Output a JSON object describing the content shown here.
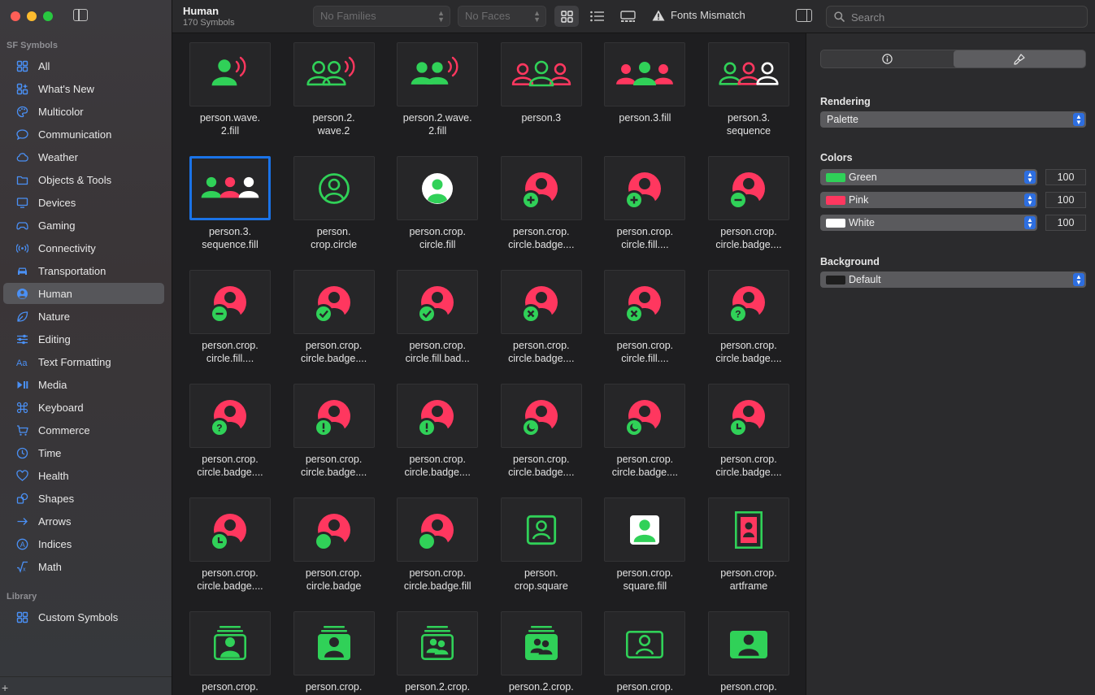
{
  "sidebar": {
    "section_symbols": "SF Symbols",
    "items": [
      {
        "label": "All",
        "icon": "grid-icon",
        "selected": false
      },
      {
        "label": "What's New",
        "icon": "sparkle-grid-icon",
        "selected": false
      },
      {
        "label": "Multicolor",
        "icon": "palette-icon",
        "selected": false
      },
      {
        "label": "Communication",
        "icon": "speech-bubble-icon",
        "selected": false
      },
      {
        "label": "Weather",
        "icon": "cloud-icon",
        "selected": false
      },
      {
        "label": "Objects & Tools",
        "icon": "folder-icon",
        "selected": false
      },
      {
        "label": "Devices",
        "icon": "desktop-icon",
        "selected": false
      },
      {
        "label": "Gaming",
        "icon": "gamecontroller-icon",
        "selected": false
      },
      {
        "label": "Connectivity",
        "icon": "antenna-icon",
        "selected": false
      },
      {
        "label": "Transportation",
        "icon": "car-icon",
        "selected": false
      },
      {
        "label": "Human",
        "icon": "person-circle-icon",
        "selected": true
      },
      {
        "label": "Nature",
        "icon": "leaf-icon",
        "selected": false
      },
      {
        "label": "Editing",
        "icon": "sliders-icon",
        "selected": false
      },
      {
        "label": "Text Formatting",
        "icon": "text-format-icon",
        "selected": false
      },
      {
        "label": "Media",
        "icon": "play-pause-icon",
        "selected": false
      },
      {
        "label": "Keyboard",
        "icon": "command-icon",
        "selected": false
      },
      {
        "label": "Commerce",
        "icon": "cart-icon",
        "selected": false
      },
      {
        "label": "Time",
        "icon": "clock-icon",
        "selected": false
      },
      {
        "label": "Health",
        "icon": "heart-icon",
        "selected": false
      },
      {
        "label": "Shapes",
        "icon": "shapes-icon",
        "selected": false
      },
      {
        "label": "Arrows",
        "icon": "arrow-right-icon",
        "selected": false
      },
      {
        "label": "Indices",
        "icon": "a-circle-icon",
        "selected": false
      },
      {
        "label": "Math",
        "icon": "square-root-icon",
        "selected": false
      }
    ],
    "section_library": "Library",
    "library_items": [
      {
        "label": "Custom Symbols",
        "icon": "grid-icon"
      }
    ],
    "add_label": "+"
  },
  "toolbar": {
    "title": "Human",
    "subtitle": "170 Symbols",
    "families_placeholder": "No Families",
    "faces_placeholder": "No Faces",
    "fonts_mismatch": "Fonts Mismatch",
    "search_placeholder": "Search"
  },
  "symbols": [
    {
      "label": "person.wave.\n2.fill",
      "icon": "person-wave-2-fill"
    },
    {
      "label": "person.2.\nwave.2",
      "icon": "person-2-wave-2"
    },
    {
      "label": "person.2.wave.\n2.fill",
      "icon": "person-2-wave-2-fill"
    },
    {
      "label": "person.3",
      "icon": "person-3"
    },
    {
      "label": "person.3.fill",
      "icon": "person-3-fill"
    },
    {
      "label": "person.3.\nsequence",
      "icon": "person-3-sequence"
    },
    {
      "label": "person.3.\nsequence.fill",
      "icon": "person-3-sequence-fill",
      "selected": true
    },
    {
      "label": "person.\ncrop.circle",
      "icon": "person-crop-circle"
    },
    {
      "label": "person.crop.\ncircle.fill",
      "icon": "person-crop-circle-fill"
    },
    {
      "label": "person.crop.\ncircle.badge....",
      "icon": "badge-plus"
    },
    {
      "label": "person.crop.\ncircle.fill....",
      "icon": "badge-plus-fill"
    },
    {
      "label": "person.crop.\ncircle.badge....",
      "icon": "badge-minus"
    },
    {
      "label": "person.crop.\ncircle.fill....",
      "icon": "badge-minus-fill"
    },
    {
      "label": "person.crop.\ncircle.badge....",
      "icon": "badge-check"
    },
    {
      "label": "person.crop.\ncircle.fill.bad...",
      "icon": "badge-check-fill"
    },
    {
      "label": "person.crop.\ncircle.badge....",
      "icon": "badge-x"
    },
    {
      "label": "person.crop.\ncircle.fill....",
      "icon": "badge-x-fill"
    },
    {
      "label": "person.crop.\ncircle.badge....",
      "icon": "badge-question"
    },
    {
      "label": "person.crop.\ncircle.badge....",
      "icon": "badge-question-fill"
    },
    {
      "label": "person.crop.\ncircle.badge....",
      "icon": "badge-exclaim"
    },
    {
      "label": "person.crop.\ncircle.badge....",
      "icon": "badge-exclaim-fill"
    },
    {
      "label": "person.crop.\ncircle.badge....",
      "icon": "badge-moon"
    },
    {
      "label": "person.crop.\ncircle.badge....",
      "icon": "badge-moon-fill"
    },
    {
      "label": "person.crop.\ncircle.badge....",
      "icon": "badge-clock"
    },
    {
      "label": "person.crop.\ncircle.badge....",
      "icon": "badge-clock-fill"
    },
    {
      "label": "person.crop.\ncircle.badge",
      "icon": "badge-dot"
    },
    {
      "label": "person.crop.\ncircle.badge.fill",
      "icon": "badge-dot-fill"
    },
    {
      "label": "person.\ncrop.square",
      "icon": "person-crop-square"
    },
    {
      "label": "person.crop.\nsquare.fill",
      "icon": "person-crop-square-fill"
    },
    {
      "label": "person.crop.\nartframe",
      "icon": "person-crop-artframe"
    },
    {
      "label": "person.crop.",
      "icon": "stack-person"
    },
    {
      "label": "person.crop.",
      "icon": "stack-person-fill"
    },
    {
      "label": "person.2.crop.",
      "icon": "stack-person-2"
    },
    {
      "label": "person.2.crop.",
      "icon": "stack-person-2-fill"
    },
    {
      "label": "person.crop.",
      "icon": "rect-person"
    },
    {
      "label": "person.crop.",
      "icon": "rect-person-fill"
    }
  ],
  "inspector": {
    "rendering_label": "Rendering",
    "rendering_value": "Palette",
    "colors_label": "Colors",
    "colors": [
      {
        "name": "Green",
        "hex": "#2fd158",
        "value": "100"
      },
      {
        "name": "Pink",
        "hex": "#ff375f",
        "value": "100"
      },
      {
        "name": "White",
        "hex": "#ffffff",
        "value": "100"
      }
    ],
    "background_label": "Background",
    "background_value": "Default",
    "background_hex": "#1e1e1e"
  },
  "colors": {
    "green": "#30d158",
    "pink": "#ff375f",
    "white": "#ffffff",
    "accent": "#1a73e8"
  }
}
